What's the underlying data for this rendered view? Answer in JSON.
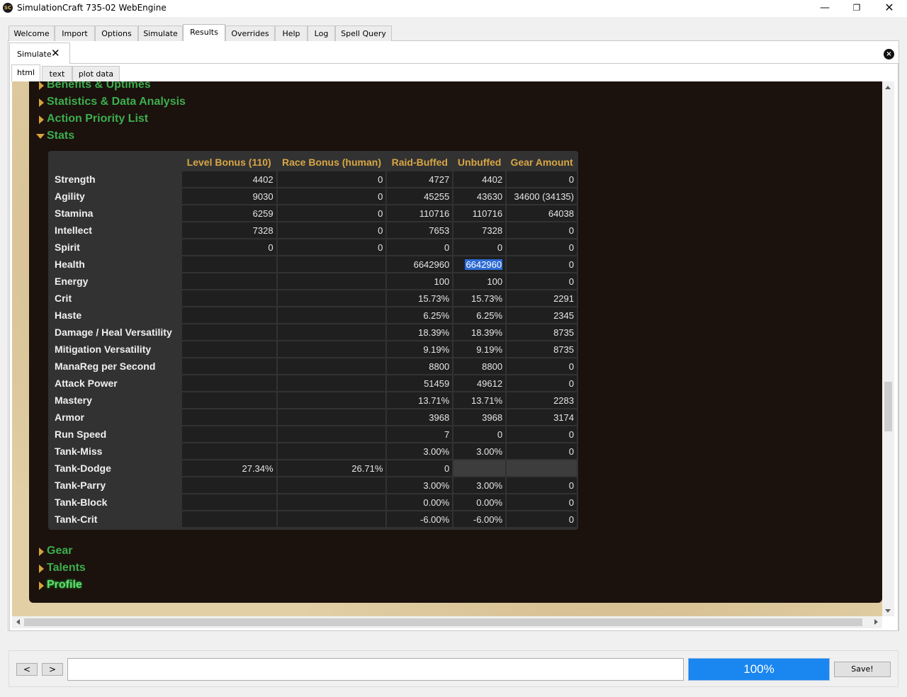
{
  "window": {
    "title": "SimulationCraft 735-02 WebEngine",
    "app_icon_text": "SC",
    "minimize_glyph": "—",
    "maximize_glyph": "❐",
    "close_glyph": "✕"
  },
  "main_tabs": [
    {
      "label": "Welcome"
    },
    {
      "label": "Import"
    },
    {
      "label": "Options"
    },
    {
      "label": "Simulate"
    },
    {
      "label": "Results",
      "active": true
    },
    {
      "label": "Overrides"
    },
    {
      "label": "Help"
    },
    {
      "label": "Log"
    },
    {
      "label": "Spell Query"
    }
  ],
  "result_tab": {
    "label": "Simulate",
    "close_glyph": "✕",
    "close_all_glyph": "×"
  },
  "sub_tabs": [
    {
      "label": "html",
      "active": true
    },
    {
      "label": "text"
    },
    {
      "label": "plot data"
    }
  ],
  "sections": {
    "benefits": "Benefits & Uptimes",
    "statistics": "Statistics & Data Analysis",
    "apl": "Action Priority List",
    "stats": "Stats",
    "gear": "Gear",
    "talents": "Talents",
    "profile": "Profile"
  },
  "stats_table": {
    "headers": [
      "",
      "Level Bonus (110)",
      "Race Bonus (human)",
      "Raid-Buffed",
      "Unbuffed",
      "Gear Amount"
    ],
    "rows": [
      [
        "Strength",
        "4402",
        "0",
        "4727",
        "4402",
        "0"
      ],
      [
        "Agility",
        "9030",
        "0",
        "45255",
        "43630",
        "34600 (34135)"
      ],
      [
        "Stamina",
        "6259",
        "0",
        "110716",
        "110716",
        "64038"
      ],
      [
        "Intellect",
        "7328",
        "0",
        "7653",
        "7328",
        "0"
      ],
      [
        "Spirit",
        "0",
        "0",
        "0",
        "0",
        "0"
      ],
      [
        "Health",
        "",
        "",
        "6642960",
        "6642960",
        "0"
      ],
      [
        "Energy",
        "",
        "",
        "100",
        "100",
        "0"
      ],
      [
        "Crit",
        "",
        "",
        "15.73%",
        "15.73%",
        "2291"
      ],
      [
        "Haste",
        "",
        "",
        "6.25%",
        "6.25%",
        "2345"
      ],
      [
        "Damage / Heal Versatility",
        "",
        "",
        "18.39%",
        "18.39%",
        "8735"
      ],
      [
        "Mitigation Versatility",
        "",
        "",
        "9.19%",
        "9.19%",
        "8735"
      ],
      [
        "ManaReg per Second",
        "",
        "",
        "8800",
        "8800",
        "0"
      ],
      [
        "Attack Power",
        "",
        "",
        "51459",
        "49612",
        "0"
      ],
      [
        "Mastery",
        "",
        "",
        "13.71%",
        "13.71%",
        "2283"
      ],
      [
        "Armor",
        "",
        "",
        "3968",
        "3968",
        "3174"
      ],
      [
        "Run Speed",
        "",
        "",
        "7",
        "0",
        "0"
      ],
      [
        "Tank-Miss",
        "",
        "",
        "3.00%",
        "3.00%",
        "0"
      ],
      [
        "Tank-Dodge",
        "27.34%",
        "26.71%",
        "0",
        null,
        null
      ],
      [
        "Tank-Parry",
        "",
        "",
        "3.00%",
        "3.00%",
        "0"
      ],
      [
        "Tank-Block",
        "",
        "",
        "0.00%",
        "0.00%",
        "0"
      ],
      [
        "Tank-Crit",
        "",
        "",
        "-6.00%",
        "-6.00%",
        "0"
      ]
    ],
    "selected_cell": {
      "row": 5,
      "col": 4
    }
  },
  "bottom_bar": {
    "back_label": "<",
    "forward_label": ">",
    "command_value": "",
    "progress_label": "100%",
    "progress_value": 100,
    "save_label": "Save!"
  }
}
